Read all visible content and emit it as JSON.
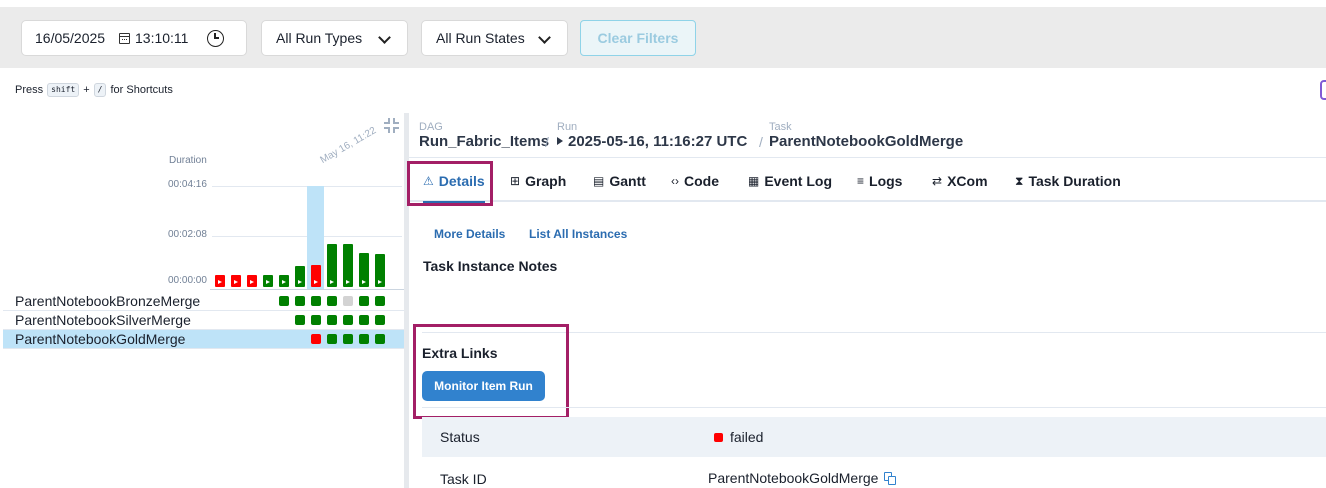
{
  "filters": {
    "date": "16/05/2025",
    "time": "13:10:11",
    "run_types": "All Run Types",
    "run_states": "All Run States",
    "clear": "Clear Filters"
  },
  "shortcuts": {
    "press": "Press",
    "key1": "shift",
    "plus": "+",
    "key2": "/",
    "suffix": "for Shortcuts"
  },
  "grid": {
    "duration_label": "Duration",
    "y_ticks": [
      "00:04:16",
      "00:02:08",
      "00:00:00"
    ],
    "run_label": "May 16, 11:22",
    "tasks": [
      "ParentNotebookBronzeMerge",
      "ParentNotebookSilverMerge",
      "ParentNotebookGoldMerge"
    ]
  },
  "chart_data": {
    "type": "bar",
    "ylabel": "Duration",
    "y_ticks": [
      "00:00:00",
      "00:02:08",
      "00:04:16"
    ],
    "ylim_seconds": [
      0,
      256
    ],
    "values_seconds": [
      10,
      10,
      10,
      25,
      25,
      51,
      54,
      105,
      107,
      83,
      80
    ],
    "states": [
      "failed",
      "failed",
      "failed",
      "success",
      "success",
      "success",
      "failed",
      "success",
      "success",
      "success",
      "success"
    ],
    "selected_index": 6,
    "colors": {
      "success": "#008000",
      "failed": "#ff0000",
      "skipped": "#d3d3d3"
    }
  },
  "task_states": [
    [
      "success",
      "success",
      "success",
      "success",
      "skipped",
      "success",
      "success"
    ],
    [
      "success",
      "success",
      "success",
      "success",
      "success",
      "success"
    ],
    [
      "failed",
      "success",
      "success",
      "success",
      "success"
    ]
  ],
  "breadcrumb": {
    "dag_key": "DAG",
    "dag": "Run_Fabric_Items",
    "run_key": "Run",
    "run": "2025-05-16, 11:16:27 UTC",
    "task_key": "Task",
    "task": "ParentNotebookGoldMerge",
    "sep": "/"
  },
  "tabs": [
    {
      "label": "Details",
      "icon": "⚠"
    },
    {
      "label": "Graph",
      "icon": "⊞"
    },
    {
      "label": "Gantt",
      "icon": "▤"
    },
    {
      "label": "Code",
      "icon": "‹›"
    },
    {
      "label": "Event Log",
      "icon": "▦"
    },
    {
      "label": "Logs",
      "icon": "≡"
    },
    {
      "label": "XCom",
      "icon": "⇄"
    },
    {
      "label": "Task Duration",
      "icon": "⧗"
    }
  ],
  "details": {
    "more_details": "More Details",
    "list_all": "List All Instances",
    "notes_heading": "Task Instance Notes",
    "extra_links": "Extra Links",
    "monitor_button": "Monitor Item Run",
    "status_label": "Status",
    "status_value": "failed",
    "taskid_label": "Task ID",
    "taskid_value": "ParentNotebookGoldMerge"
  }
}
